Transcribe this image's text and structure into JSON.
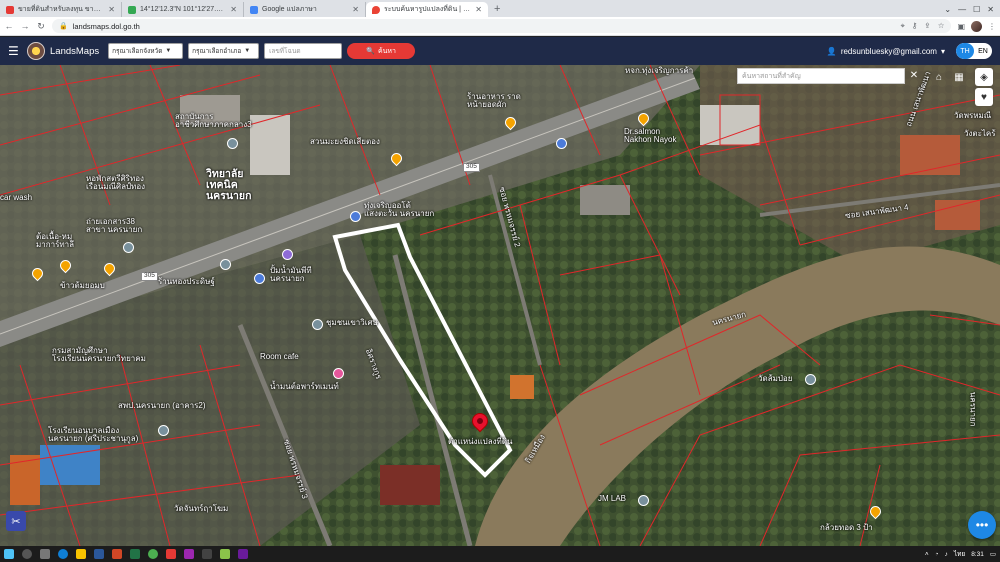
{
  "browser": {
    "tabs": [
      {
        "label": "ขายที่ดินสำหรับลงทุน ขายที่ดินทำเล | DDproperty",
        "favicon_color": "#e53935",
        "active": false
      },
      {
        "label": "14°12'12.3\"N 101°12'27.3\"E - Go",
        "favicon_color": "#34a853",
        "active": false
      },
      {
        "label": "Google แปลภาษา",
        "favicon_color": "#4285f4",
        "active": false
      },
      {
        "label": "ระบบค้นหารูปแปลงที่ดิน | LandsMaps",
        "favicon_color": "#ea4335",
        "active": true
      }
    ],
    "new_tab": "+",
    "url": "landsmaps.dol.go.th"
  },
  "app": {
    "brand": "LandsMaps",
    "province_select": "กรุณาเลือกจังหวัด",
    "amphoe_select": "กรุณาเลือกอำเภอ",
    "deed_placeholder": "เลขที่โฉนด",
    "search_label": "ค้นหา",
    "user_email": "redsunbluesky@gmail.com",
    "lang_th": "TH",
    "lang_en": "EN"
  },
  "map": {
    "search_placeholder": "ค้นหาสถานที่สำคัญ",
    "marker_label": "ตำแหน่งแปลงที่ดิน",
    "road_shield": "305",
    "labels": [
      {
        "text": "หจก.ทุ่งเจริญการค้า",
        "kind": "small"
      },
      {
        "text": "ร้านอาหาร ราด\nหน้ายอดผัก",
        "kind": "small"
      },
      {
        "text": "สถาบันการ\nอาชีวศึกษาภาคกลาง3",
        "kind": "small"
      },
      {
        "text": "สวนมะยงชิดเสียตอง",
        "kind": "small"
      },
      {
        "text": "Dr.salmon\nNakhon Nayok",
        "kind": "small"
      },
      {
        "text": "วิทยาลัย\nเทคนิค\nนครนายก",
        "kind": "big"
      },
      {
        "text": "หอพักสตรีศิริทอง\nเรือนมณีศิลป์ทอง",
        "kind": "small"
      },
      {
        "text": "car wash",
        "kind": "small"
      },
      {
        "text": "ถ่ายเอกสาร38\nสาขา นครนายก",
        "kind": "small"
      },
      {
        "text": "ต้อเนื้อ-หมู\nมาการ์ทาลี",
        "kind": "small"
      },
      {
        "text": "ข้าวต้มยอมบ",
        "kind": "small"
      },
      {
        "text": "ทุ่งเจริญออโต้\nแสงตะวัน นครนายก",
        "kind": "small"
      },
      {
        "text": "ร้านทองประดิษฐ์",
        "kind": "small"
      },
      {
        "text": "ปั้มน้ำมันพีที\nนครนายก",
        "kind": "small"
      },
      {
        "text": "ชุมชนเขาวิเศษ",
        "kind": "small"
      },
      {
        "text": "กรมสามัญศึกษา\nโรงเรียนนครนายกวิทยาคม",
        "kind": "small"
      },
      {
        "text": "Room cafe",
        "kind": "small"
      },
      {
        "text": "น้ำมนต์อพาร์ทเมนท์",
        "kind": "small"
      },
      {
        "text": "สพป.นครนายก (อาคาร2)",
        "kind": "small"
      },
      {
        "text": "โรงเรียนอนุบาลเมือง\nนครนายก (ศรีประชานุกูล)",
        "kind": "small"
      },
      {
        "text": "อิศรางกูร",
        "kind": "small"
      },
      {
        "text": "ซอย เสนาพัฒนา 4",
        "kind": "small"
      },
      {
        "text": "นครนายก",
        "kind": "small"
      },
      {
        "text": "วัดส้มป่อย",
        "kind": "small"
      },
      {
        "text": "JM LAB",
        "kind": "small"
      },
      {
        "text": "วัดพรหมณี",
        "kind": "small"
      },
      {
        "text": "กล้วยทอด 3 ป้า",
        "kind": "small"
      },
      {
        "text": "วัดจันทร์ฤาโฆม",
        "kind": "small"
      },
      {
        "text": "ซอย พรหมจรรย์ 2",
        "kind": "small"
      },
      {
        "text": "ซอย พรหมจรรย์ 3",
        "kind": "small"
      },
      {
        "text": "วังตะไคร้",
        "kind": "small"
      },
      {
        "text": "กิจเหมือง",
        "kind": "small"
      },
      {
        "text": "ถนน เสนาพัฒนา",
        "kind": "small"
      },
      {
        "text": "นครนายก",
        "kind": "small"
      }
    ]
  },
  "taskbar": {
    "lang": "ไทย",
    "time": "8:31"
  }
}
